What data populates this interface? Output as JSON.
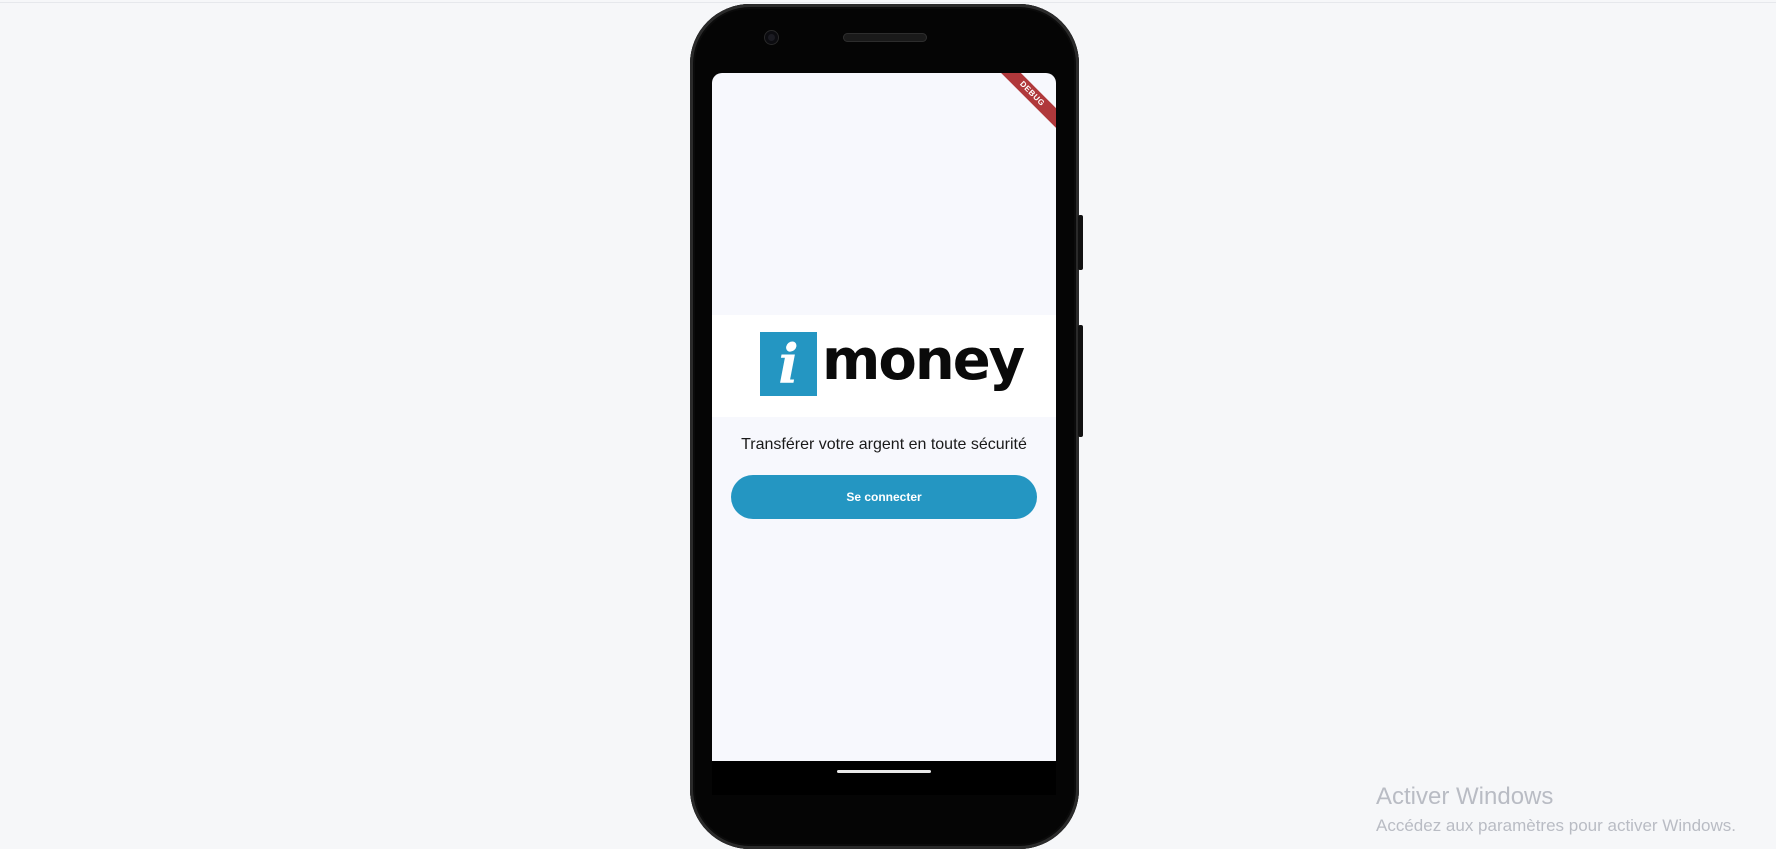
{
  "status_bar": {
    "time": "",
    "icons": ""
  },
  "debug_banner": "DEBUG",
  "logo": {
    "mark_letter": "i",
    "word": "money",
    "brand_color": "#2496c2"
  },
  "tagline": "Transférer votre argent en toute sécurité",
  "login_button": {
    "label": "Se connecter",
    "color": "#2496c2"
  },
  "windows_activation": {
    "title": "Activer Windows",
    "subtitle": "Accédez aux paramètres pour activer Windows."
  }
}
